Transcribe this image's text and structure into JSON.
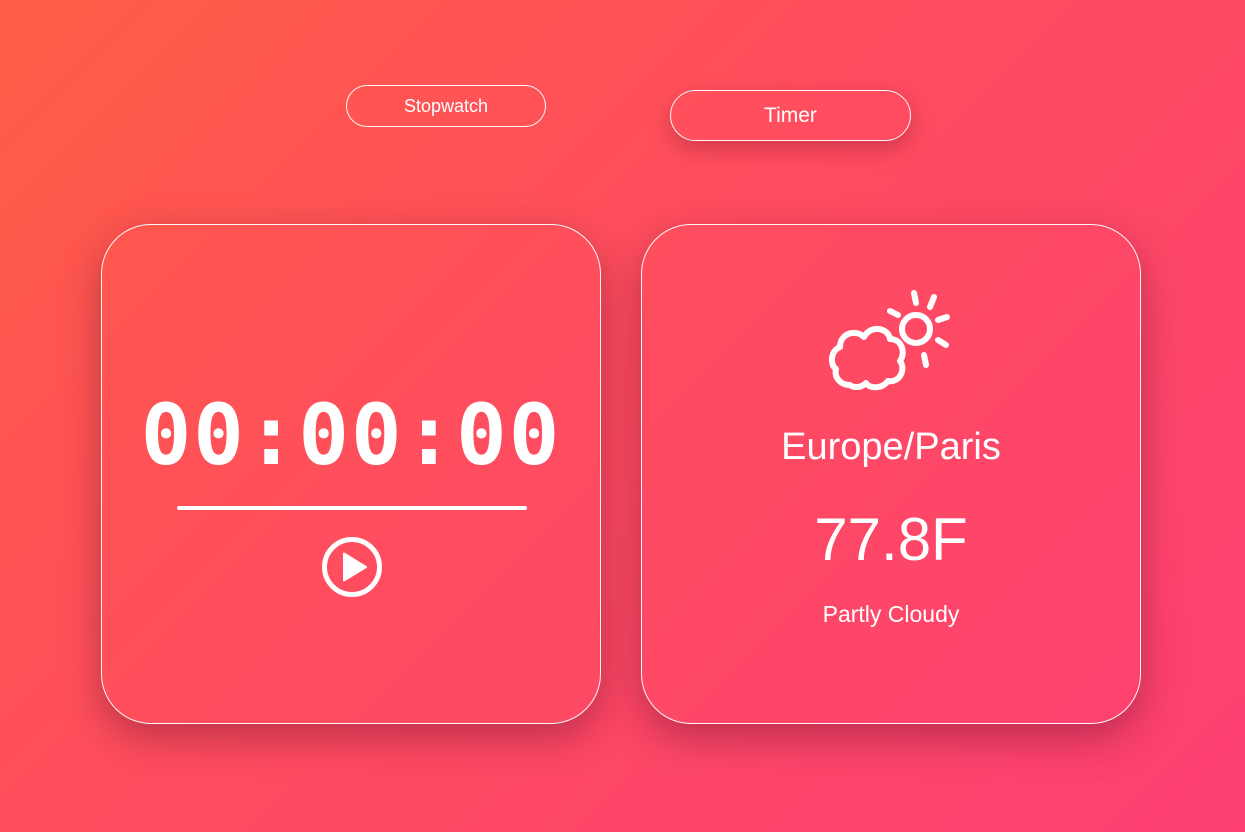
{
  "tabs": {
    "stopwatch_label": "Stopwatch",
    "timer_label": "Timer"
  },
  "stopwatch": {
    "time": "00:00:00",
    "control_icon": "play-circle-icon"
  },
  "weather": {
    "icon": "partly-cloudy-icon",
    "location": "Europe/Paris",
    "temperature": "77.8F",
    "condition": "Partly Cloudy"
  },
  "colors": {
    "gradient_start": "#ff5d45",
    "gradient_mid": "#ff4d5f",
    "gradient_end": "#fd3f73",
    "foreground": "#ffffff"
  }
}
